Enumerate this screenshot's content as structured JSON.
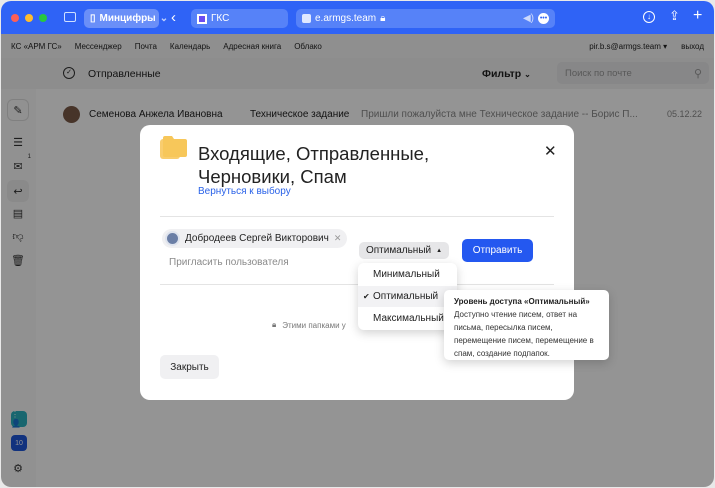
{
  "browser": {
    "tab_group": "Минцифры",
    "tab": "ГКС",
    "address": "e.armgs.team",
    "accent": "#2f63f6"
  },
  "nav": {
    "items": [
      "КС «АРМ ГС»",
      "Мессенджер",
      "Почта",
      "Календарь",
      "Адресная книга",
      "Облако"
    ],
    "user": "pir.b.s@armgs.team",
    "logout": "выход"
  },
  "header": {
    "folder": "Отправленные",
    "filter": "Фильтр",
    "search_placeholder": "Поиск по почте"
  },
  "sidebar": {
    "inbox_badge": "1",
    "calendar_day": "10"
  },
  "email": {
    "sender": "Семенова Анжела Ивановна",
    "subject": "Техническое задание",
    "preview": "Пришли пожалуйста мне Техническое задание -- Борис П...",
    "date": "05.12.22"
  },
  "modal": {
    "title": "Входящие, Отправленные, Черновики, Спам",
    "back_link": "Вернуться к выбору",
    "chip_name": "Добродеев Сергей Викторович",
    "invite_placeholder": "Пригласить пользователя",
    "access_level": "Оптимальный",
    "send": "Отправить",
    "note": "Этими папками у",
    "close": "Закрыть"
  },
  "dropdown": {
    "options": [
      "Минимальный",
      "Оптимальный",
      "Максимальный"
    ],
    "selected": "Оптимальный"
  },
  "tooltip": {
    "title": "Уровень доступа «Оптимальный»",
    "text": "Доступно чтение писем, ответ на письма, пересылка писем, перемещение писем, перемещение в спам, создание подпапок."
  }
}
